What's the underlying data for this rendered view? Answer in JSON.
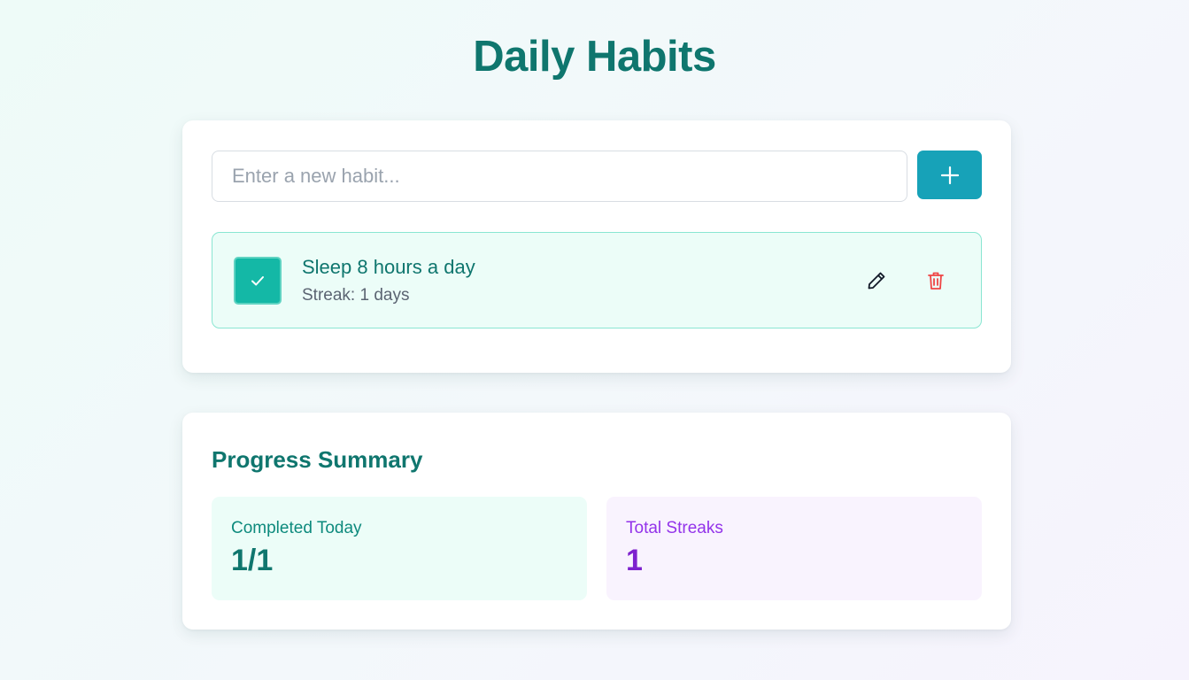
{
  "header": {
    "title": "Daily Habits"
  },
  "new_habit": {
    "placeholder": "Enter a new habit...",
    "value": "",
    "add_icon": "plus-icon"
  },
  "habits": [
    {
      "name": "Sleep 8 hours a day",
      "streak_text": "Streak: 1 days",
      "completed": true,
      "check_icon": "check-icon",
      "edit_icon": "pencil-icon",
      "delete_icon": "trash-icon"
    }
  ],
  "summary": {
    "title": "Progress Summary",
    "completed_today": {
      "label": "Completed Today",
      "value": "1/1"
    },
    "total_streaks": {
      "label": "Total Streaks",
      "value": "1"
    }
  },
  "colors": {
    "primary": "#0f766e",
    "teal_accent": "#14b8a6",
    "add_button": "#17a2b8",
    "delete": "#ef4444",
    "purple": "#7e22ce"
  }
}
